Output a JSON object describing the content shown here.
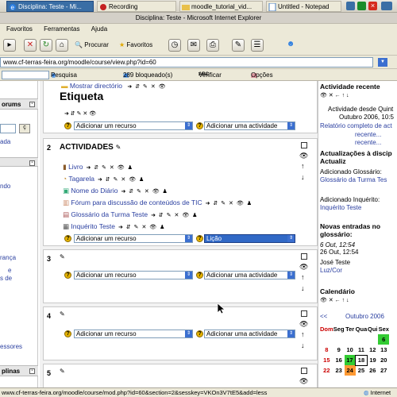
{
  "taskbar": {
    "items": [
      {
        "label": "Disciplina: Teste - Mi..."
      },
      {
        "label": "Recording"
      },
      {
        "label": "moodle_tutorial_vid..."
      },
      {
        "label": "Untitled - Notepad"
      }
    ]
  },
  "window": {
    "title": "Disciplina: Teste - Microsoft Internet Explorer"
  },
  "menu": {
    "items": [
      "Favoritos",
      "Ferramentas",
      "Ajuda"
    ]
  },
  "toolbar": {
    "search": "Procurar",
    "favorites": "Favoritos"
  },
  "address": {
    "url": "www.cf-terras-feira.org/moodle/course/view.php?id=60"
  },
  "google": {
    "search": "Pesquisa",
    "blocked": "289 bloqueado(s)",
    "verify": "Verificar",
    "options": "Opções"
  },
  "left": {
    "forums": "orums",
    "search_btn": "ç",
    "advanced": "ada",
    "ndo": "ndo",
    "ranca": "rança",
    "e": "e",
    "sde": "s de",
    "essores": "essores",
    "plinas": "plinas"
  },
  "section0": {
    "show_dir": "Mostrar directório",
    "label": "Etiqueta",
    "add_resource": "Adicionar um recurso",
    "add_activity": "Adicionar uma actividade"
  },
  "section2": {
    "num": "2",
    "title": "ACTIVIDADES",
    "items": [
      {
        "label": "Livro"
      },
      {
        "label": "Tagarela"
      },
      {
        "label": "Nome do Diário"
      },
      {
        "label": "Fórum para discussão de conteúdos de TIC"
      },
      {
        "label": "Glossário da Turma Teste"
      },
      {
        "label": "Inquérito Teste"
      }
    ],
    "add_resource": "Adicionar um recurso",
    "add_activity": "Lição"
  },
  "section3": {
    "num": "3",
    "add_resource": "Adicionar um recurso",
    "add_activity": "Adicionar uma actividade"
  },
  "section4": {
    "num": "4",
    "add_resource": "Adicionar um recurso",
    "add_activity": "Adicionar uma actividade"
  },
  "section5": {
    "num": "5"
  },
  "right": {
    "recent_title": "Actividade recente",
    "since": "Actividade desde Quint",
    "since_date": "Outubro 2006, 10:5",
    "full_report": "Relatório completo de act",
    "recent1": "recente...",
    "recent2": "recente...",
    "updates_title": "Actualizações à discip",
    "updates_title2": "Actualiz",
    "added_glossary": "Adicionado Glossário:",
    "glossary_link": "Glossário da Turma Tes",
    "added_survey": "Adicionado Inquérito:",
    "survey_link": "Inquérito Teste",
    "new_entries": "Novas entradas no",
    "glossary": "glossário:",
    "date1": "6 Out, 12:54",
    "date2": "26 Out, 12:54",
    "author": "José Teste",
    "entry": "Luz/Cor",
    "calendar_title": "Calendário",
    "month": "Outubro 2006",
    "prev": "<<",
    "days": [
      "Dom",
      "Seg",
      "Ter",
      "Qua",
      "Qui",
      "Sex"
    ],
    "week1": [
      "",
      "",
      "",
      "",
      "",
      "6"
    ],
    "week2": [
      "8",
      "9",
      "10",
      "11",
      "12",
      "13"
    ],
    "week3": [
      "15",
      "16",
      "17",
      "18",
      "19",
      "20"
    ],
    "week4": [
      "22",
      "23",
      "24",
      "25",
      "26",
      "27"
    ]
  },
  "status": {
    "url": "www.cf-terras-feira.org/moodle/course/mod.php?id=60&section=2&sesskey=VKOn3V7tE5&add=less",
    "zone": "Internet"
  }
}
